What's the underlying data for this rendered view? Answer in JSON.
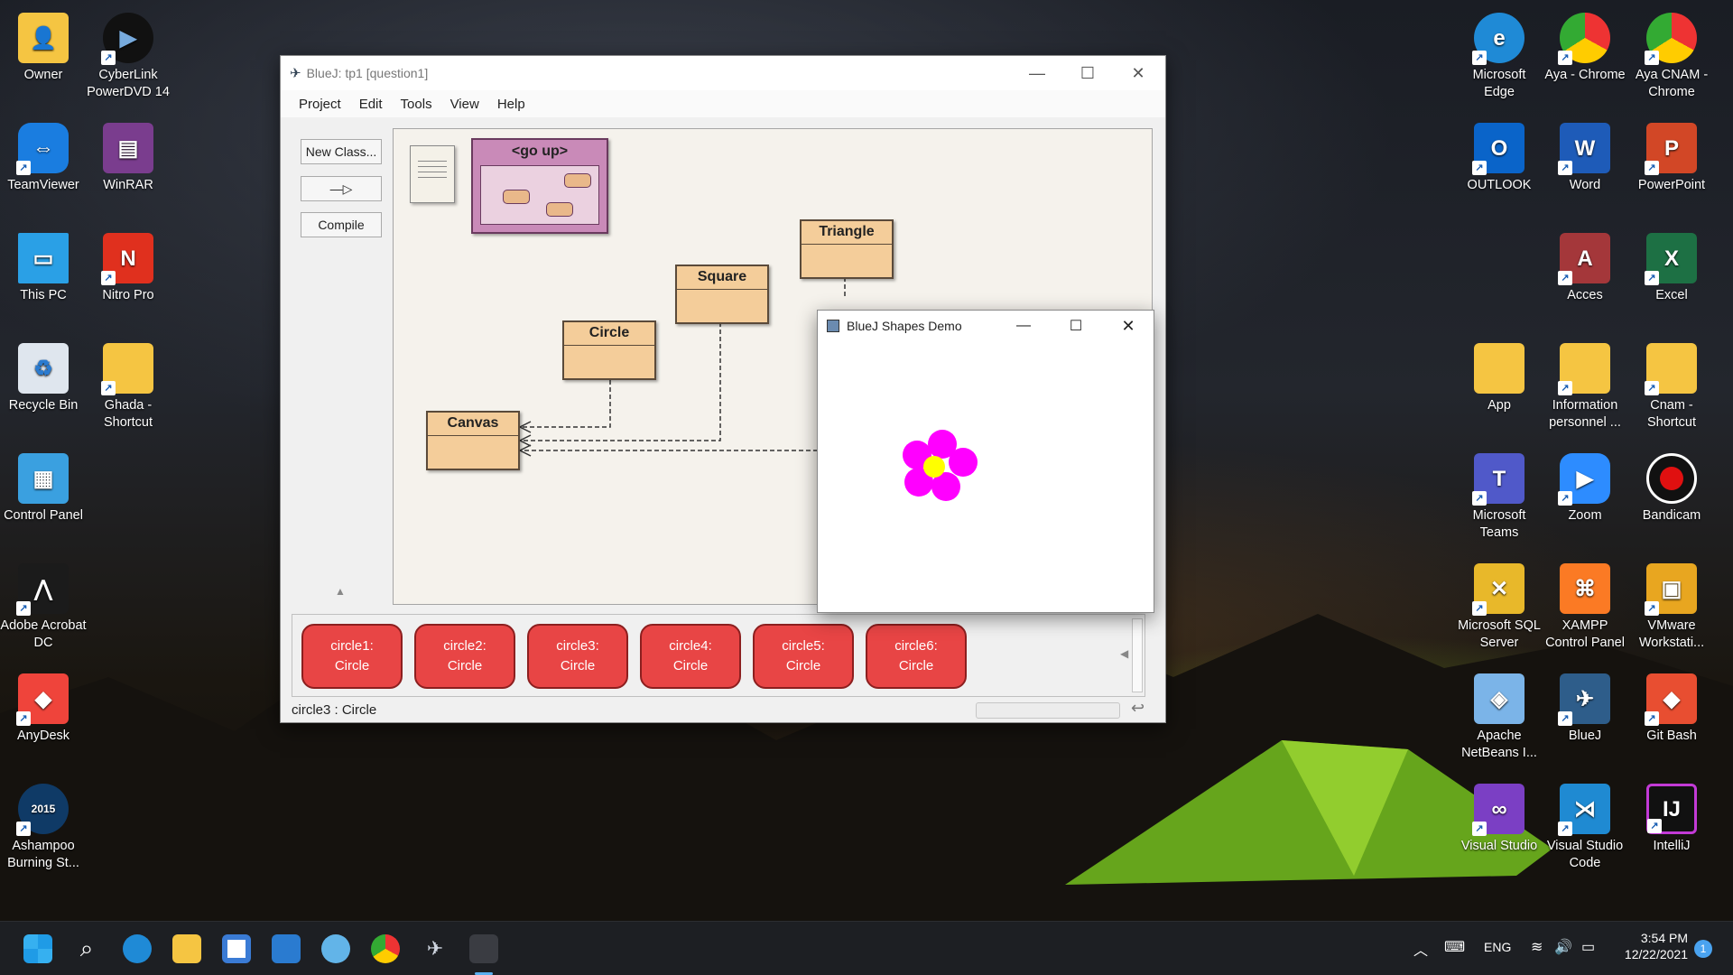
{
  "desktop": {
    "left_icons": [
      {
        "label": "Owner"
      },
      {
        "label": "CyberLink PowerDVD 14"
      },
      {
        "label": "TeamViewer"
      },
      {
        "label": "WinRAR"
      },
      {
        "label": "This PC"
      },
      {
        "label": "Nitro Pro"
      },
      {
        "label": "Recycle Bin"
      },
      {
        "label": "Ghada - Shortcut"
      },
      {
        "label": "Control Panel"
      },
      {
        "label": "Adobe Acrobat DC"
      },
      {
        "label": "AnyDesk"
      },
      {
        "label": "Ashampoo Burning St..."
      }
    ],
    "right_icons": [
      {
        "label": "Microsoft Edge"
      },
      {
        "label": "Aya - Chrome"
      },
      {
        "label": "Aya CNAM - Chrome"
      },
      {
        "label": "OUTLOOK"
      },
      {
        "label": "Word"
      },
      {
        "label": "PowerPoint"
      },
      {
        "label": "Acces"
      },
      {
        "label": "Excel"
      },
      {
        "label": "App"
      },
      {
        "label": "Information personnel ..."
      },
      {
        "label": "Cnam - Shortcut"
      },
      {
        "label": "Microsoft Teams"
      },
      {
        "label": "Zoom"
      },
      {
        "label": "Bandicam"
      },
      {
        "label": "Microsoft SQL Server"
      },
      {
        "label": "XAMPP Control Panel"
      },
      {
        "label": "VMware Workstati..."
      },
      {
        "label": "Apache NetBeans I..."
      },
      {
        "label": "BlueJ"
      },
      {
        "label": "Git Bash"
      },
      {
        "label": "Visual Studio"
      },
      {
        "label": "Visual Studio Code"
      },
      {
        "label": "IntelliJ"
      }
    ],
    "ashampoo_badge": "2015"
  },
  "bluej": {
    "title": "BlueJ:  tp1  [question1]",
    "menu": [
      "Project",
      "Edit",
      "Tools",
      "View",
      "Help"
    ],
    "buttons": {
      "new_class": "New Class...",
      "arrow": "—▷",
      "compile": "Compile"
    },
    "go_up": "<go up>",
    "classes": [
      "Triangle",
      "Square",
      "Circle",
      "Canvas"
    ],
    "objects": [
      {
        "line1": "circle1:",
        "line2": "Circle"
      },
      {
        "line1": "circle2:",
        "line2": "Circle"
      },
      {
        "line1": "circle3:",
        "line2": "Circle"
      },
      {
        "line1": "circle4:",
        "line2": "Circle"
      },
      {
        "line1": "circle5:",
        "line2": "Circle"
      },
      {
        "line1": "circle6:",
        "line2": "Circle"
      }
    ],
    "status": "circle3 : Circle"
  },
  "shapes_demo": {
    "title": "BlueJ Shapes Demo",
    "petal_color": "#ff00ff",
    "center_color": "#ffff00"
  },
  "taskbar": {
    "language": "ENG",
    "time": "3:54 PM",
    "date": "12/22/2021",
    "notification_count": "1"
  }
}
